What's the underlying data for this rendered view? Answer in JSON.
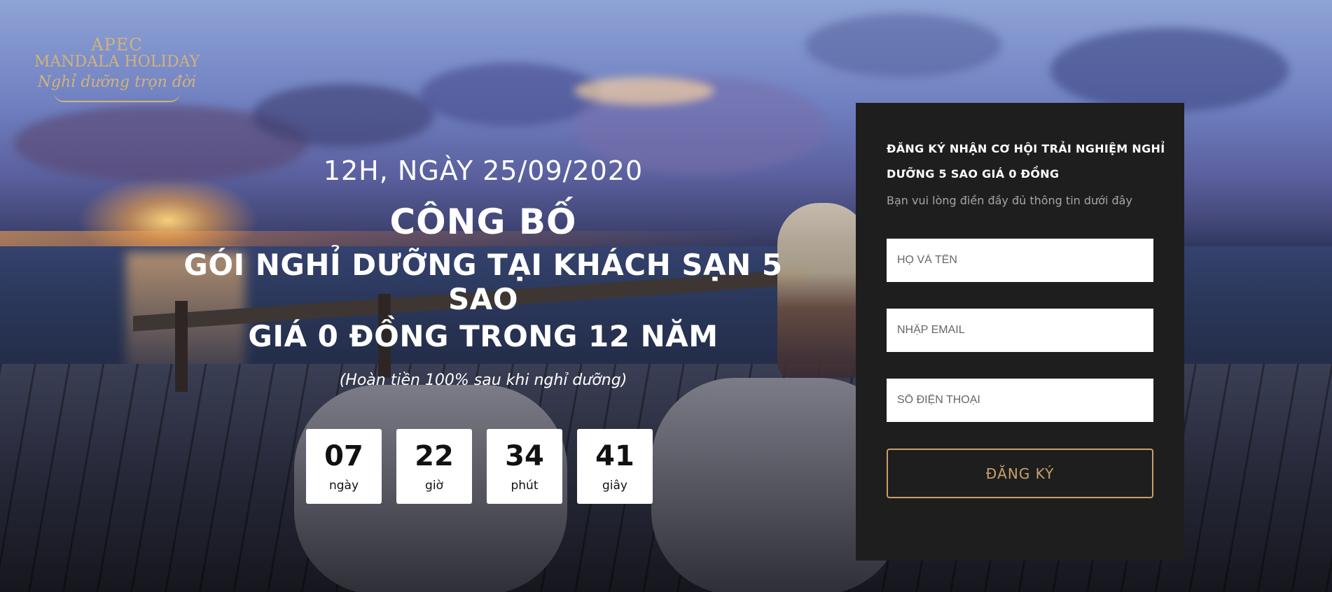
{
  "logo": {
    "line1": "APEC",
    "line2": "MANDALA HOLIDAY",
    "script": "Nghỉ dưỡng trọn đời"
  },
  "headline": {
    "date": "12H, NGÀY 25/09/2020",
    "title": "CÔNG BỐ",
    "subtitle_line1": "GÓI NGHỈ DƯỠNG TẠI KHÁCH SẠN 5 SAO",
    "subtitle_line2": "GIÁ 0 ĐỒNG TRONG 12 NĂM",
    "refund_note": "(Hoàn tiền 100% sau khi nghỉ dưỡng)"
  },
  "countdown": [
    {
      "value": "07",
      "label": "ngày"
    },
    {
      "value": "22",
      "label": "giờ"
    },
    {
      "value": "34",
      "label": "phút"
    },
    {
      "value": "41",
      "label": "giây"
    }
  ],
  "form": {
    "title": "ĐĂNG KÝ NHẬN CƠ HỘI TRẢI NGHIỆM NGHỈ DƯỠNG 5 SAO GIÁ 0 ĐỒNG",
    "subtitle": "Bạn vui lòng điền đầy đủ thông tin dưới đây",
    "name_placeholder": "HỌ VÀ TÊN",
    "email_placeholder": "NHẬP EMAIL",
    "phone_placeholder": "SỐ ĐIỆN THOẠI",
    "submit_label": "ĐĂNG KÝ"
  },
  "colors": {
    "accent_gold": "#c9a06a",
    "panel_bg": "#1e1e1e",
    "logo_gold": "#d3b27a"
  }
}
